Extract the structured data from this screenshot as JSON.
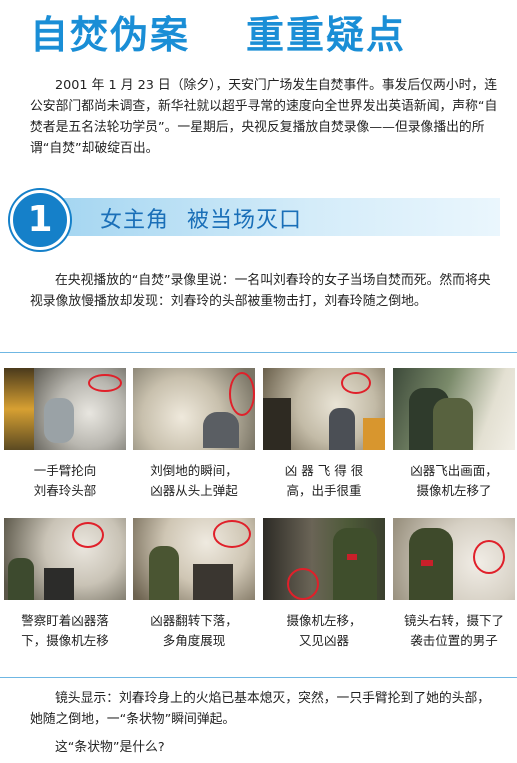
{
  "title": {
    "part1": "自焚伪案",
    "part2": "重重疑点"
  },
  "intro": "2001 年 1 月 23 日（除夕），天安门广场发生自焚事件。事发后仅两小时，连公安部门都尚未调查，新华社就以超乎寻常的速度向全世界发出英语新闻，声称“自焚者是五名法轮功学员”。一星期后，央视反复播放自焚录像——但录像播出的所谓“自焚”却破绽百出。",
  "section": {
    "number": "1",
    "title_a": "女主角",
    "title_b": "被当场灭口"
  },
  "paragraph2": "在央视播放的“自焚”录像里说：一名叫刘春玲的女子当场自焚而死。然而将央视录像放慢播放却发现：刘春玲的头部被重物击打，刘春玲随之倒地。",
  "frames": [
    {
      "line1": "一手臂抡向",
      "line2": "刘春玲头部"
    },
    {
      "line1": "刘倒地的瞬间，",
      "line2": "凶器从头上弹起"
    },
    {
      "line1": "凶 器 飞 得 很",
      "line2": "高，出手很重"
    },
    {
      "line1": "凶器飞出画面，",
      "line2": "摄像机左移了"
    },
    {
      "line1": "警察盯着凶器落",
      "line2": "下，摄像机左移"
    },
    {
      "line1": "凶器翻转下落，",
      "line2": "多角度展现"
    },
    {
      "line1": "摄像机左移，",
      "line2": "又见凶器"
    },
    {
      "line1": "镜头右转，摄下了",
      "line2": "袭击位置的男子"
    }
  ],
  "paragraph3": "镜头显示：刘春玲身上的火焰已基本熄灭，突然，一只手臂抡到了她的头部，她随之倒地，一“条状物”瞬间弹起。",
  "paragraph4": "这“条状物”是什么?",
  "colors": {
    "title": "#1a8ed6",
    "section": "#1580c9",
    "marker": "#e0202a"
  }
}
